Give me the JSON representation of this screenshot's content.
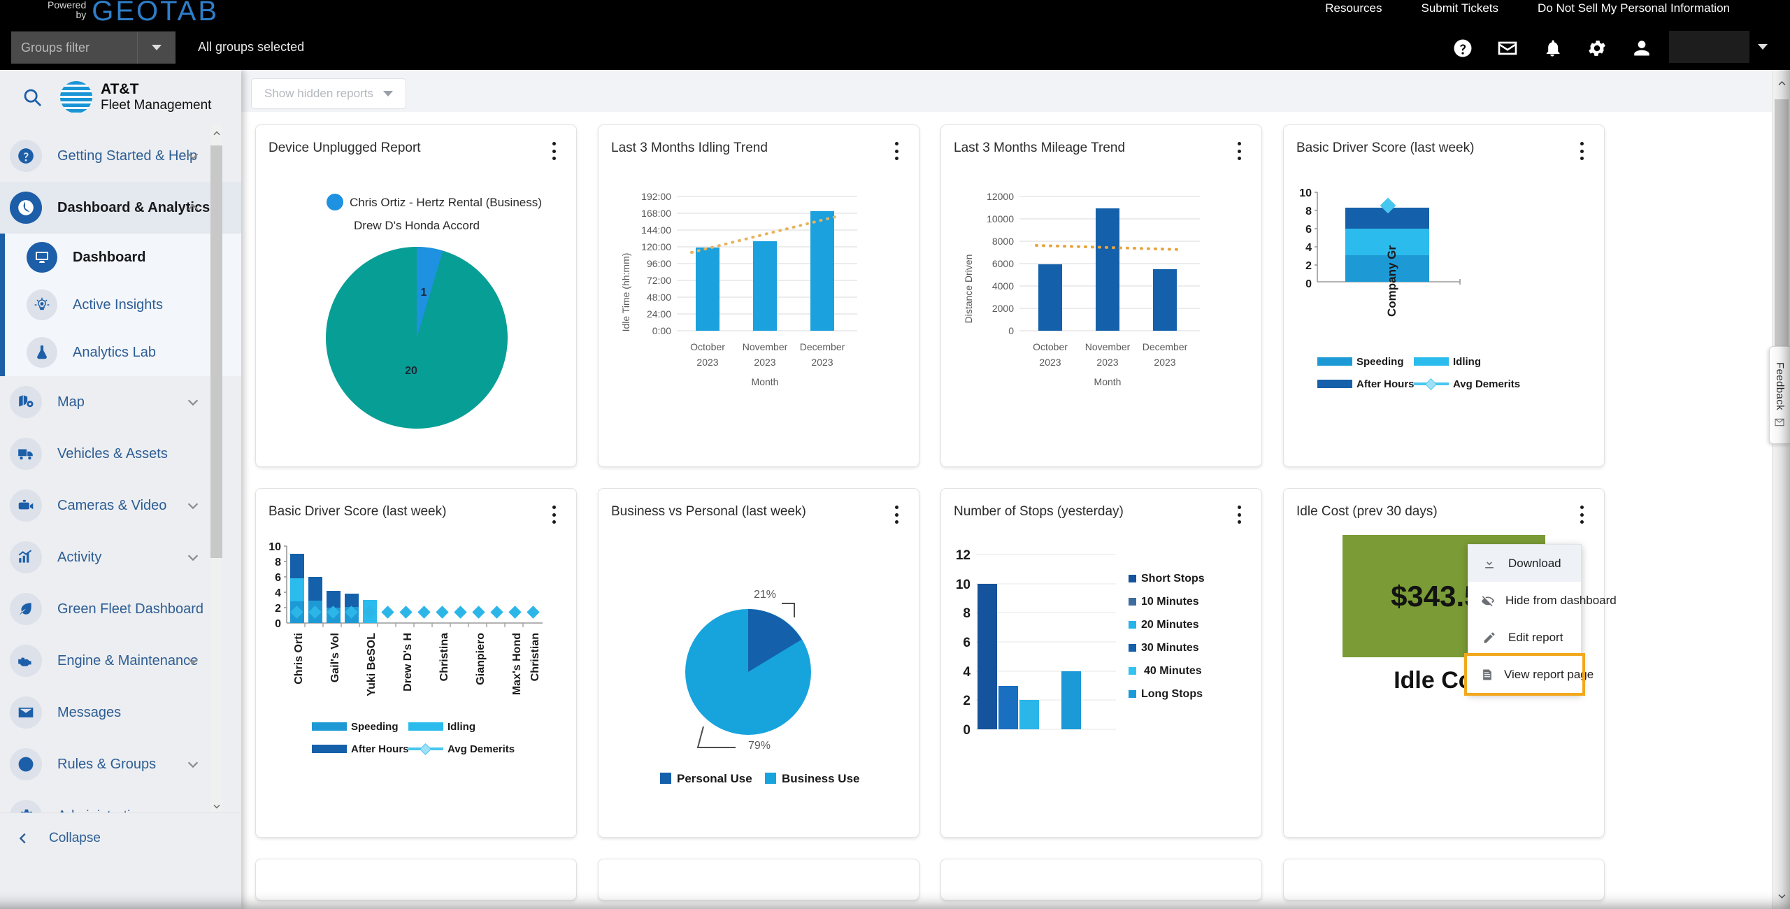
{
  "topbar": {
    "powered_line1": "Powered",
    "powered_line2": "by",
    "brand": "GEOTAB",
    "links": [
      {
        "label": "Resources"
      },
      {
        "label": "Submit Tickets"
      },
      {
        "label": "Do Not Sell My Personal Information"
      }
    ],
    "groups_filter_placeholder": "Groups filter",
    "groups_status": "All groups selected",
    "icons": [
      "help-icon",
      "mail-icon",
      "bell-icon",
      "gear-icon",
      "user-icon"
    ]
  },
  "sidebar": {
    "product_name_line1": "AT&T",
    "product_name_line2": "Fleet Management",
    "collapse_label": "Collapse",
    "items": [
      {
        "label": "Getting Started & Help",
        "icon": "help-circle-icon",
        "expandable": true,
        "expanded": false
      },
      {
        "label": "Dashboard & Analytics",
        "icon": "pie-chart-icon",
        "expandable": true,
        "expanded": true,
        "active": true
      },
      {
        "label": "Map",
        "icon": "map-icon",
        "expandable": true,
        "expanded": false
      },
      {
        "label": "Vehicles & Assets",
        "icon": "truck-icon",
        "expandable": false
      },
      {
        "label": "Cameras & Video",
        "icon": "camera-icon",
        "expandable": true,
        "expanded": false
      },
      {
        "label": "Activity",
        "icon": "bar-chart-icon",
        "expandable": true,
        "expanded": false
      },
      {
        "label": "Green Fleet Dashboard",
        "icon": "leaf-icon",
        "expandable": false
      },
      {
        "label": "Engine & Maintenance",
        "icon": "engine-icon",
        "expandable": true,
        "expanded": false
      },
      {
        "label": "Messages",
        "icon": "envelope-icon",
        "expandable": false
      },
      {
        "label": "Rules & Groups",
        "icon": "no-entry-icon",
        "expandable": true,
        "expanded": false
      },
      {
        "label": "Administration",
        "icon": "gear-icon",
        "expandable": true,
        "expanded": false
      }
    ],
    "subitems": [
      {
        "label": "Dashboard",
        "icon": "monitor-chart-icon",
        "selected": true
      },
      {
        "label": "Active Insights",
        "icon": "lightbulb-icon",
        "selected": false
      },
      {
        "label": "Analytics Lab",
        "icon": "flask-icon",
        "selected": false
      }
    ]
  },
  "toolbar": {
    "show_hidden_reports": "Show hidden reports"
  },
  "feedback": {
    "label": "Feedback"
  },
  "context_menu": {
    "items": [
      {
        "label": "Download",
        "icon": "download-icon",
        "highlighted": false
      },
      {
        "label": "Hide from dashboard",
        "icon": "eye-off-icon",
        "highlighted": false
      },
      {
        "label": "Edit report",
        "icon": "pencil-icon",
        "highlighted": false
      },
      {
        "label": "View report page",
        "icon": "document-icon",
        "highlighted": true
      }
    ],
    "highlight_color": "#f2a81d"
  },
  "cards": [
    {
      "title": "Device Unplugged Report"
    },
    {
      "title": "Last 3 Months Idling Trend"
    },
    {
      "title": "Last 3 Months Mileage Trend"
    },
    {
      "title": "Basic Driver Score (last week)"
    },
    {
      "title": "Basic Driver Score (last week)"
    },
    {
      "title": "Business vs Personal (last week)"
    },
    {
      "title": "Number of Stops (yesterday)"
    },
    {
      "title": "Idle Cost (prev 30 days)"
    }
  ],
  "idle_cost": {
    "value": "$343.59",
    "caption": "Idle Cost",
    "tile_color": "#7a9b36"
  },
  "chart_data": [
    {
      "type": "pie",
      "title": "Device Unplugged Report",
      "legend_position": "top",
      "labels": [
        "Chris Ortiz - Hertz Rental (Business)",
        "Drew D's Honda Accord"
      ],
      "values": [
        1,
        20
      ],
      "data_labels": [
        "1",
        "20"
      ],
      "colors": [
        "#1e91e0",
        "#079e95"
      ]
    },
    {
      "type": "bar",
      "title": "Last 3 Months Idling Trend",
      "categories": [
        "October 2023",
        "November 2023",
        "December 2023"
      ],
      "values": [
        119,
        128,
        171
      ],
      "xlabel": "Month",
      "ylabel": "Idle Time (hh:mm)",
      "ytick_labels": [
        "0:00",
        "24:00",
        "48:00",
        "72:00",
        "96:00",
        "120:00",
        "144:00",
        "168:00",
        "192:00"
      ],
      "ylim": [
        0,
        192
      ],
      "grid": true,
      "bar_color": "#1ba1dd",
      "trendline": {
        "style": "dotted",
        "color": "#e8b35e",
        "values": [
          112,
          140,
          164
        ]
      }
    },
    {
      "type": "bar",
      "title": "Last 3 Months Mileage Trend",
      "categories": [
        "October 2023",
        "November 2023",
        "December 2023"
      ],
      "values": [
        5950,
        10950,
        5520
      ],
      "xlabel": "Month",
      "ylabel": "Distance Driven",
      "ytick_labels": [
        "0",
        "2000",
        "4000",
        "6000",
        "8000",
        "10000",
        "12000"
      ],
      "ylim": [
        0,
        12000
      ],
      "grid": true,
      "bar_color": "#1560ab",
      "trendline": {
        "style": "dotted",
        "color": "#e8a33c",
        "values": [
          7650,
          7450,
          7280
        ]
      }
    },
    {
      "type": "bar",
      "title": "Basic Driver Score (last week)",
      "stacked": true,
      "categories": [
        "Company Gr"
      ],
      "series": [
        {
          "name": "Speeding",
          "values": [
            3.0
          ],
          "color": "#1d9ad6"
        },
        {
          "name": "Idling",
          "values": [
            3.0
          ],
          "color": "#2bbbec"
        },
        {
          "name": "After Hours",
          "values": [
            2.4
          ],
          "color": "#1560ab"
        }
      ],
      "marker_series": {
        "name": "Avg Demerits",
        "values": [
          8.7
        ],
        "color": "#47c7ef"
      },
      "ytick_labels": [
        "0",
        "2",
        "4",
        "6",
        "8",
        "10"
      ],
      "ylim": [
        0,
        10
      ],
      "legend": [
        "Speeding",
        "Idling",
        "After Hours",
        "Avg Demerits"
      ]
    },
    {
      "type": "bar",
      "title": "Basic Driver Score (last week)",
      "stacked": true,
      "categories": [
        "Chris Orti",
        "",
        "Gail's Vol",
        "",
        "Yuki BeSOL",
        "",
        "Drew D's H",
        "",
        "Christina",
        "",
        "Gianpiero",
        "",
        "Max's Hond",
        "",
        "Christian"
      ],
      "series": [
        {
          "name": "Speeding",
          "values": [
            2.8,
            2.9,
            2.0,
            2.1,
            3.0,
            0,
            0,
            0,
            0,
            0,
            0,
            0,
            0,
            0,
            0
          ],
          "color": "#1d9ad6"
        },
        {
          "name": "Idling",
          "values": [
            3.0,
            0,
            0,
            0,
            0,
            0,
            0,
            0,
            0,
            0,
            0,
            0,
            0,
            0,
            0
          ],
          "color": "#2bbbec"
        },
        {
          "name": "After Hours",
          "values": [
            3.2,
            3.1,
            2.2,
            1.7,
            0,
            0,
            0,
            0,
            0,
            0,
            0,
            0,
            0,
            0,
            0
          ],
          "color": "#1560ab"
        }
      ],
      "marker_series": {
        "name": "Avg Demerits",
        "values": [
          1.4,
          1.4,
          1.4,
          1.4,
          1.4,
          1.4,
          1.4,
          1.4,
          1.4,
          1.4,
          1.4,
          1.4,
          1.4,
          1.4,
          1.4
        ],
        "color": "#47c7ef"
      },
      "ytick_labels": [
        "0",
        "2",
        "4",
        "6",
        "8",
        "10"
      ],
      "ylim": [
        0,
        10
      ],
      "legend": [
        "Speeding",
        "Idling",
        "After Hours",
        "Avg Demerits"
      ]
    },
    {
      "type": "pie",
      "title": "Business vs Personal (last week)",
      "labels": [
        "Personal Use",
        "Business Use"
      ],
      "values": [
        21,
        79
      ],
      "data_labels": [
        "21%",
        "79%"
      ],
      "colors": [
        "#1560ab",
        "#17a4dd"
      ],
      "legend_position": "bottom"
    },
    {
      "type": "bar",
      "title": "Number of Stops (yesterday)",
      "categories": [
        "Short Stops",
        "10 Minutes",
        "20 Minutes",
        "30 Minutes",
        "40 Minutes",
        "Long Stops"
      ],
      "values": [
        10,
        3,
        2,
        0,
        0,
        4
      ],
      "ytick_labels": [
        "0",
        "2",
        "4",
        "6",
        "8",
        "10",
        "12"
      ],
      "ylim": [
        0,
        12
      ],
      "grid": true,
      "colors": [
        "#15539c",
        "#1a6fc0",
        "#2bb6ea",
        "#1560ab",
        "#35c3f0",
        "#1c9ad8"
      ],
      "legend": [
        "Short Stops",
        "10 Minutes",
        "20 Minutes",
        "30 Minutes",
        " 40 Minutes",
        "Long Stops"
      ],
      "legend_position": "right"
    },
    {
      "type": "table",
      "title": "Idle Cost (prev 30 days)",
      "values": [
        "$343.59"
      ],
      "categories": [
        "Idle Cost"
      ]
    }
  ]
}
